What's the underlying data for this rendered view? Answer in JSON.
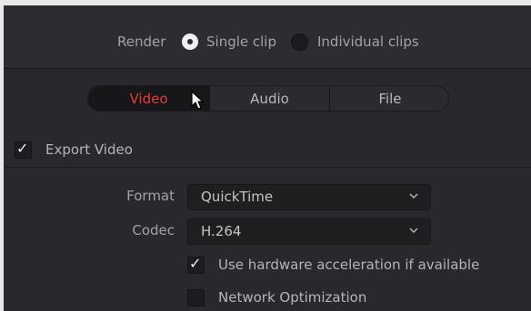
{
  "render": {
    "label": "Render",
    "options": [
      "Single clip",
      "Individual clips"
    ],
    "selected": "Single clip"
  },
  "tabs": [
    {
      "label": "Video",
      "active": true
    },
    {
      "label": "Audio",
      "active": false
    },
    {
      "label": "File",
      "active": false
    }
  ],
  "export_video": {
    "label": "Export Video",
    "checked": true
  },
  "format": {
    "label": "Format",
    "value": "QuickTime"
  },
  "codec": {
    "label": "Codec",
    "value": "H.264"
  },
  "hardware_accel": {
    "label": "Use hardware acceleration if available",
    "checked": true
  },
  "network_opt": {
    "label": "Network Optimization",
    "checked": false
  },
  "colors": {
    "active_tab": "#e23b3b",
    "panel_bg": "#29292d"
  }
}
